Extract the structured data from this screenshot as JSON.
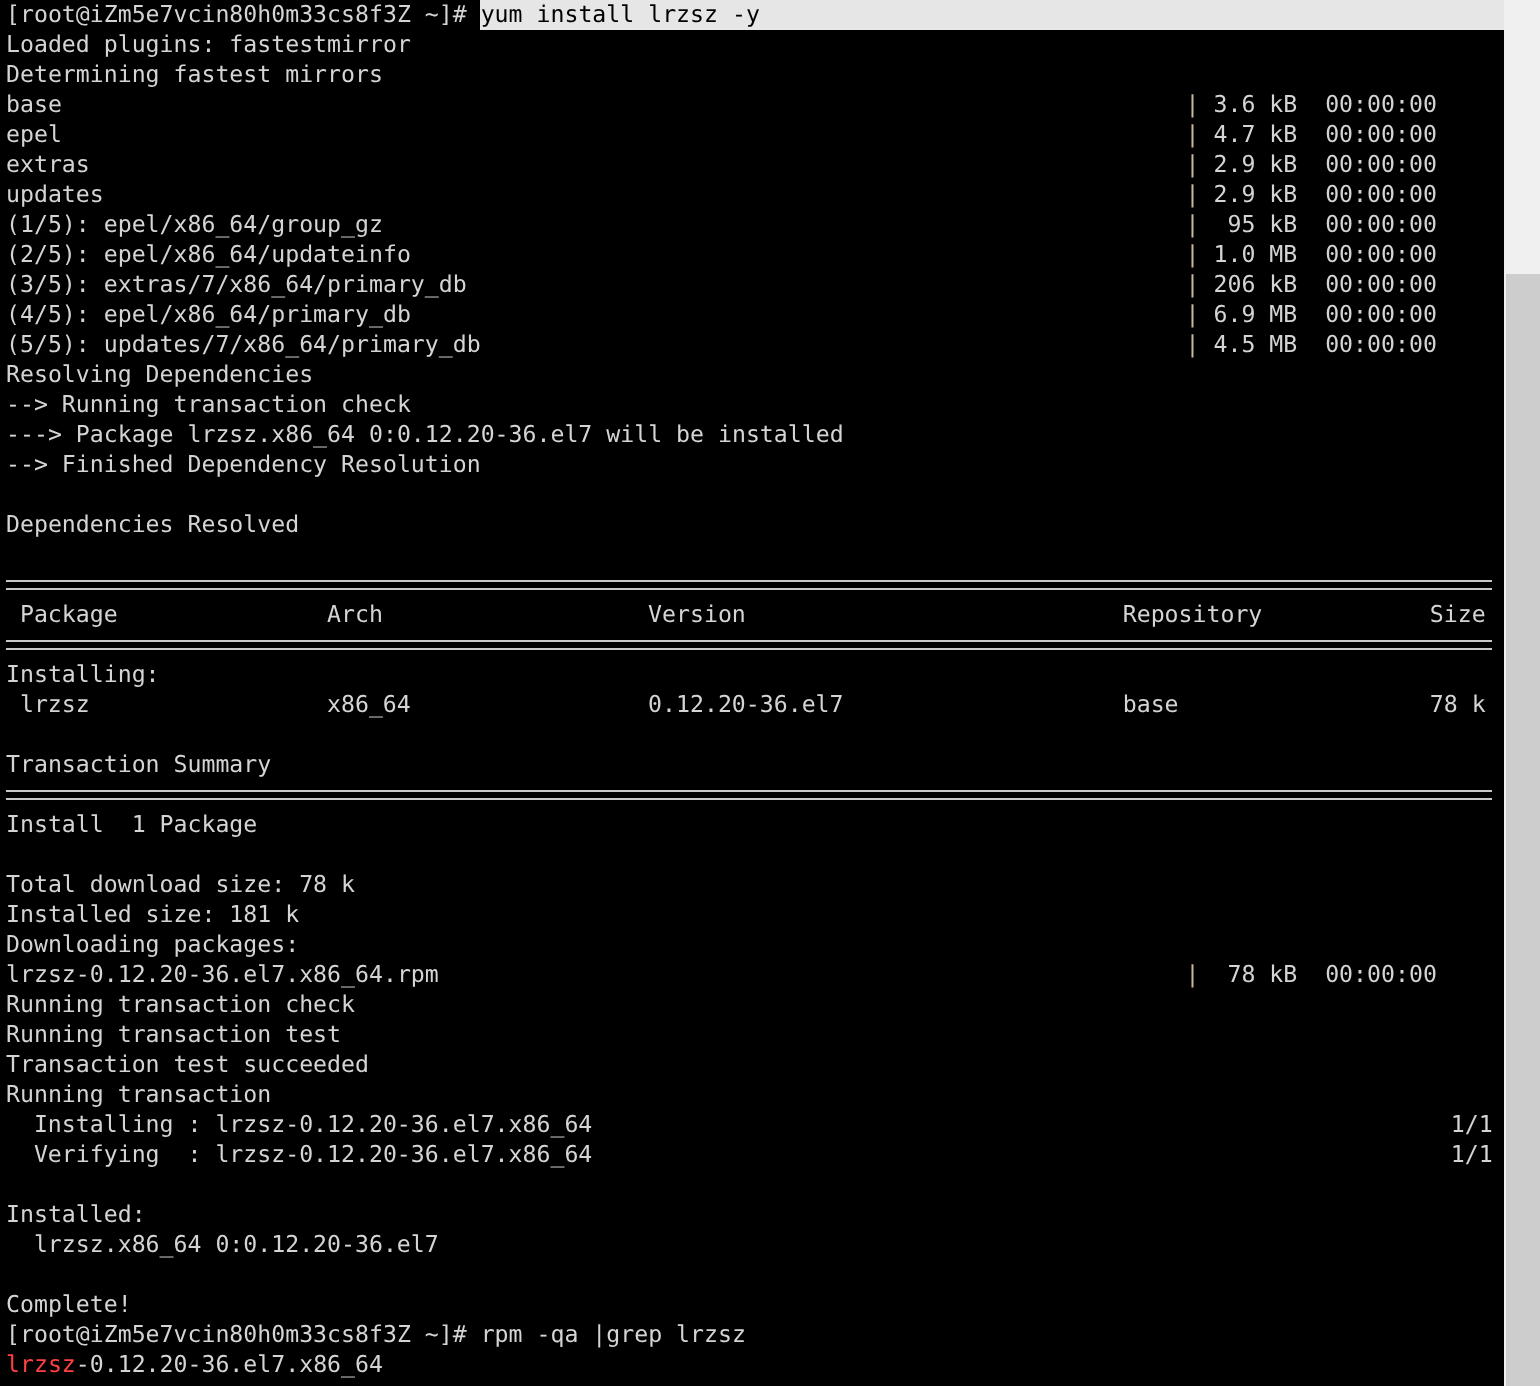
{
  "terminal": {
    "lines": [
      {
        "kind": "prompt",
        "prompt": "[root@iZm5e7vcin80h0m33cs8f3Z ~]#",
        "command": "yum install lrzsz -y",
        "selected": true
      },
      {
        "kind": "text",
        "text": "Loaded plugins: fastestmirror"
      },
      {
        "kind": "text",
        "text": "Determining fastest mirrors"
      },
      {
        "kind": "progress",
        "name": "base",
        "bar": "|",
        "size": "3.6 kB",
        "time": "00:00:00"
      },
      {
        "kind": "progress",
        "name": "epel",
        "bar": "|",
        "size": "4.7 kB",
        "time": "00:00:00"
      },
      {
        "kind": "progress",
        "name": "extras",
        "bar": "|",
        "size": "2.9 kB",
        "time": "00:00:00"
      },
      {
        "kind": "progress",
        "name": "updates",
        "bar": "|",
        "size": "2.9 kB",
        "time": "00:00:00"
      },
      {
        "kind": "progress",
        "name": "(1/5): epel/x86_64/group_gz",
        "bar": "|",
        "size": "95 kB",
        "time": "00:00:00"
      },
      {
        "kind": "progress",
        "name": "(2/5): epel/x86_64/updateinfo",
        "bar": "|",
        "size": "1.0 MB",
        "time": "00:00:00"
      },
      {
        "kind": "progress",
        "name": "(3/5): extras/7/x86_64/primary_db",
        "bar": "|",
        "size": "206 kB",
        "time": "00:00:00"
      },
      {
        "kind": "progress",
        "name": "(4/5): epel/x86_64/primary_db",
        "bar": "|",
        "size": "6.9 MB",
        "time": "00:00:00"
      },
      {
        "kind": "progress",
        "name": "(5/5): updates/7/x86_64/primary_db",
        "bar": "|",
        "size": "4.5 MB",
        "time": "00:00:00"
      },
      {
        "kind": "text",
        "text": "Resolving Dependencies"
      },
      {
        "kind": "text",
        "text": "--> Running transaction check"
      },
      {
        "kind": "text",
        "text": "---> Package lrzsz.x86_64 0:0.12.20-36.el7 will be installed"
      },
      {
        "kind": "text",
        "text": "--> Finished Dependency Resolution"
      },
      {
        "kind": "blank"
      },
      {
        "kind": "text",
        "text": "Dependencies Resolved"
      },
      {
        "kind": "blank"
      },
      {
        "kind": "rule"
      },
      {
        "kind": "table_row",
        "cells": [
          "Package",
          "Arch",
          "Version",
          "Repository",
          "Size"
        ]
      },
      {
        "kind": "rule"
      },
      {
        "kind": "text",
        "text": "Installing:"
      },
      {
        "kind": "table_row",
        "cells": [
          "lrzsz",
          "x86_64",
          "0.12.20-36.el7",
          "base",
          "78 k"
        ]
      },
      {
        "kind": "blank"
      },
      {
        "kind": "text",
        "text": "Transaction Summary"
      },
      {
        "kind": "rule"
      },
      {
        "kind": "text",
        "text": "Install  1 Package"
      },
      {
        "kind": "blank"
      },
      {
        "kind": "text",
        "text": "Total download size: 78 k"
      },
      {
        "kind": "text",
        "text": "Installed size: 181 k"
      },
      {
        "kind": "text",
        "text": "Downloading packages:"
      },
      {
        "kind": "progress",
        "name": "lrzsz-0.12.20-36.el7.x86_64.rpm",
        "bar": "|",
        "size": "78 kB",
        "time": "00:00:00"
      },
      {
        "kind": "text",
        "text": "Running transaction check"
      },
      {
        "kind": "text",
        "text": "Running transaction test"
      },
      {
        "kind": "text",
        "text": "Transaction test succeeded"
      },
      {
        "kind": "text",
        "text": "Running transaction"
      },
      {
        "kind": "step",
        "text": "Installing : lrzsz-0.12.20-36.el7.x86_64",
        "count": "1/1"
      },
      {
        "kind": "step",
        "text": "Verifying  : lrzsz-0.12.20-36.el7.x86_64",
        "count": "1/1"
      },
      {
        "kind": "blank"
      },
      {
        "kind": "text",
        "text": "Installed:"
      },
      {
        "kind": "indented",
        "text": "lrzsz.x86_64 0:0.12.20-36.el7"
      },
      {
        "kind": "blank"
      },
      {
        "kind": "text",
        "text": "Complete!"
      },
      {
        "kind": "prompt",
        "prompt": "[root@iZm5e7vcin80h0m33cs8f3Z ~]#",
        "command": "rpm -qa |grep lrzsz",
        "selected": false
      },
      {
        "kind": "match",
        "segments": [
          {
            "text": "lrzsz",
            "match": true
          },
          {
            "text": "-0.12.20-36.el7.x86_64",
            "match": false
          }
        ]
      }
    ]
  }
}
